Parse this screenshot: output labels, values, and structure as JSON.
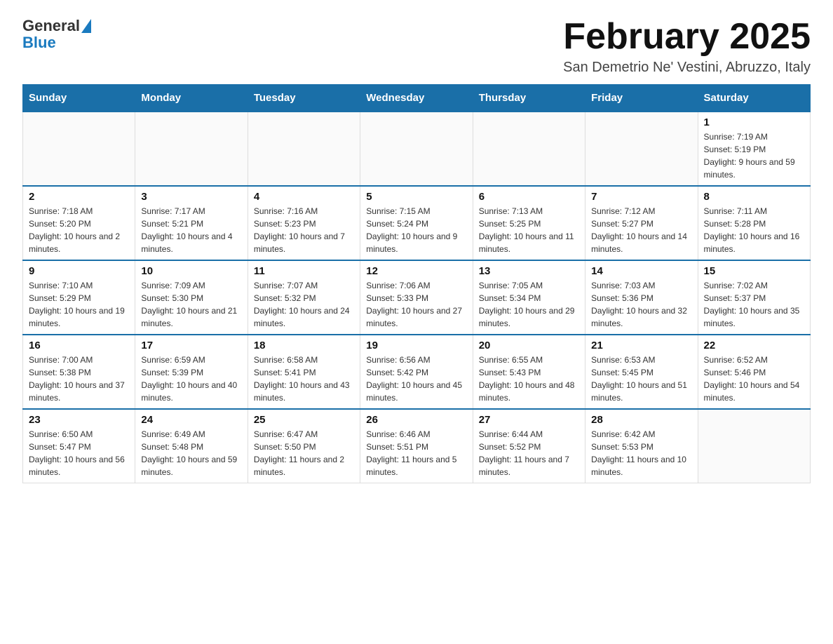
{
  "header": {
    "logo": {
      "general": "General",
      "blue": "Blue"
    },
    "title": "February 2025",
    "location": "San Demetrio Ne' Vestini, Abruzzo, Italy"
  },
  "days_of_week": [
    "Sunday",
    "Monday",
    "Tuesday",
    "Wednesday",
    "Thursday",
    "Friday",
    "Saturday"
  ],
  "weeks": [
    [
      {
        "day": "",
        "info": ""
      },
      {
        "day": "",
        "info": ""
      },
      {
        "day": "",
        "info": ""
      },
      {
        "day": "",
        "info": ""
      },
      {
        "day": "",
        "info": ""
      },
      {
        "day": "",
        "info": ""
      },
      {
        "day": "1",
        "info": "Sunrise: 7:19 AM\nSunset: 5:19 PM\nDaylight: 9 hours and 59 minutes."
      }
    ],
    [
      {
        "day": "2",
        "info": "Sunrise: 7:18 AM\nSunset: 5:20 PM\nDaylight: 10 hours and 2 minutes."
      },
      {
        "day": "3",
        "info": "Sunrise: 7:17 AM\nSunset: 5:21 PM\nDaylight: 10 hours and 4 minutes."
      },
      {
        "day": "4",
        "info": "Sunrise: 7:16 AM\nSunset: 5:23 PM\nDaylight: 10 hours and 7 minutes."
      },
      {
        "day": "5",
        "info": "Sunrise: 7:15 AM\nSunset: 5:24 PM\nDaylight: 10 hours and 9 minutes."
      },
      {
        "day": "6",
        "info": "Sunrise: 7:13 AM\nSunset: 5:25 PM\nDaylight: 10 hours and 11 minutes."
      },
      {
        "day": "7",
        "info": "Sunrise: 7:12 AM\nSunset: 5:27 PM\nDaylight: 10 hours and 14 minutes."
      },
      {
        "day": "8",
        "info": "Sunrise: 7:11 AM\nSunset: 5:28 PM\nDaylight: 10 hours and 16 minutes."
      }
    ],
    [
      {
        "day": "9",
        "info": "Sunrise: 7:10 AM\nSunset: 5:29 PM\nDaylight: 10 hours and 19 minutes."
      },
      {
        "day": "10",
        "info": "Sunrise: 7:09 AM\nSunset: 5:30 PM\nDaylight: 10 hours and 21 minutes."
      },
      {
        "day": "11",
        "info": "Sunrise: 7:07 AM\nSunset: 5:32 PM\nDaylight: 10 hours and 24 minutes."
      },
      {
        "day": "12",
        "info": "Sunrise: 7:06 AM\nSunset: 5:33 PM\nDaylight: 10 hours and 27 minutes."
      },
      {
        "day": "13",
        "info": "Sunrise: 7:05 AM\nSunset: 5:34 PM\nDaylight: 10 hours and 29 minutes."
      },
      {
        "day": "14",
        "info": "Sunrise: 7:03 AM\nSunset: 5:36 PM\nDaylight: 10 hours and 32 minutes."
      },
      {
        "day": "15",
        "info": "Sunrise: 7:02 AM\nSunset: 5:37 PM\nDaylight: 10 hours and 35 minutes."
      }
    ],
    [
      {
        "day": "16",
        "info": "Sunrise: 7:00 AM\nSunset: 5:38 PM\nDaylight: 10 hours and 37 minutes."
      },
      {
        "day": "17",
        "info": "Sunrise: 6:59 AM\nSunset: 5:39 PM\nDaylight: 10 hours and 40 minutes."
      },
      {
        "day": "18",
        "info": "Sunrise: 6:58 AM\nSunset: 5:41 PM\nDaylight: 10 hours and 43 minutes."
      },
      {
        "day": "19",
        "info": "Sunrise: 6:56 AM\nSunset: 5:42 PM\nDaylight: 10 hours and 45 minutes."
      },
      {
        "day": "20",
        "info": "Sunrise: 6:55 AM\nSunset: 5:43 PM\nDaylight: 10 hours and 48 minutes."
      },
      {
        "day": "21",
        "info": "Sunrise: 6:53 AM\nSunset: 5:45 PM\nDaylight: 10 hours and 51 minutes."
      },
      {
        "day": "22",
        "info": "Sunrise: 6:52 AM\nSunset: 5:46 PM\nDaylight: 10 hours and 54 minutes."
      }
    ],
    [
      {
        "day": "23",
        "info": "Sunrise: 6:50 AM\nSunset: 5:47 PM\nDaylight: 10 hours and 56 minutes."
      },
      {
        "day": "24",
        "info": "Sunrise: 6:49 AM\nSunset: 5:48 PM\nDaylight: 10 hours and 59 minutes."
      },
      {
        "day": "25",
        "info": "Sunrise: 6:47 AM\nSunset: 5:50 PM\nDaylight: 11 hours and 2 minutes."
      },
      {
        "day": "26",
        "info": "Sunrise: 6:46 AM\nSunset: 5:51 PM\nDaylight: 11 hours and 5 minutes."
      },
      {
        "day": "27",
        "info": "Sunrise: 6:44 AM\nSunset: 5:52 PM\nDaylight: 11 hours and 7 minutes."
      },
      {
        "day": "28",
        "info": "Sunrise: 6:42 AM\nSunset: 5:53 PM\nDaylight: 11 hours and 10 minutes."
      },
      {
        "day": "",
        "info": ""
      }
    ]
  ]
}
